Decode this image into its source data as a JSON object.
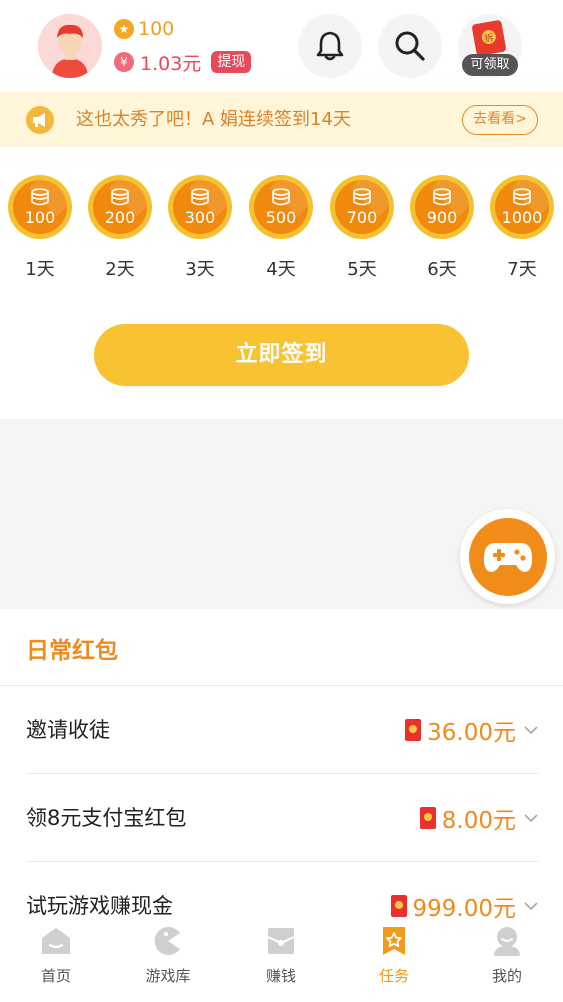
{
  "header": {
    "coins": "100",
    "coin_icon": "star-coin-icon",
    "money": "1.03元",
    "money_icon": "yuan-icon",
    "withdraw_label": "提现",
    "redpack_seal": "拆",
    "redpack_label": "可领取"
  },
  "notice": {
    "text": "这也太秀了吧！A 娟连续签到14天",
    "button": "去看看>"
  },
  "checkin": {
    "days": [
      {
        "amount": "100",
        "label": "1天"
      },
      {
        "amount": "200",
        "label": "2天"
      },
      {
        "amount": "300",
        "label": "3天"
      },
      {
        "amount": "500",
        "label": "4天"
      },
      {
        "amount": "700",
        "label": "5天"
      },
      {
        "amount": "900",
        "label": "6天"
      },
      {
        "amount": "1000",
        "label": "7天"
      }
    ],
    "button": "立即签到"
  },
  "daily": {
    "title": "日常红包",
    "rows": [
      {
        "name": "邀请收徒",
        "amount": "36.00元"
      },
      {
        "name": "领8元支付宝红包",
        "amount": "8.00元"
      },
      {
        "name": "试玩游戏赚现金",
        "amount": "999.00元"
      }
    ]
  },
  "tabs": [
    {
      "label": "首页",
      "icon": "home-icon"
    },
    {
      "label": "游戏库",
      "icon": "game-library-icon"
    },
    {
      "label": "赚钱",
      "icon": "earn-icon"
    },
    {
      "label": "任务",
      "icon": "task-icon",
      "active": true
    },
    {
      "label": "我的",
      "icon": "profile-icon"
    }
  ],
  "colors": {
    "accent": "#F29B1B",
    "gold": "#F8C233",
    "red": "#E9485A",
    "notice_bg": "#FFF6D9"
  }
}
